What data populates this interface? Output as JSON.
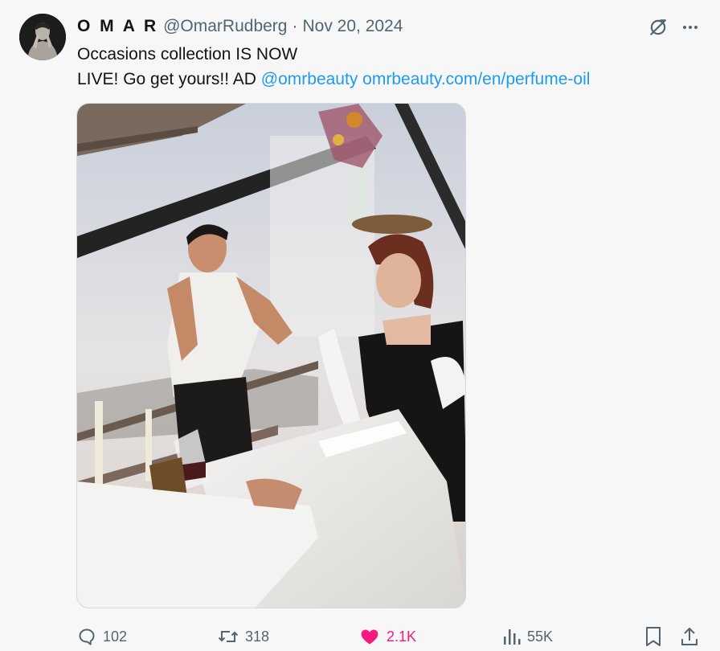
{
  "author": {
    "display_name": "O M A R",
    "handle": "@OmarRudberg",
    "separator": "·",
    "date": "Nov 20, 2024"
  },
  "tweet": {
    "line1": "Occasions collection IS NOW",
    "line2_text": "LIVE! Go get yours!! AD ",
    "mention": "@omrbeauty",
    "link": "omrbeauty.com/en/perfume-oil"
  },
  "icons": {
    "grok": "grok-icon",
    "more": "more-icon",
    "reply": "reply-icon",
    "retweet": "retweet-icon",
    "like": "heart-icon",
    "views": "views-icon",
    "bookmark": "bookmark-icon",
    "share": "share-icon"
  },
  "stats": {
    "replies": "102",
    "retweets": "318",
    "likes": "2.1K",
    "views": "55K"
  },
  "colors": {
    "text": "#0f1419",
    "secondary": "#536471",
    "link": "#1d9bf0",
    "like": "#f91880",
    "background": "#f7f7f7"
  }
}
